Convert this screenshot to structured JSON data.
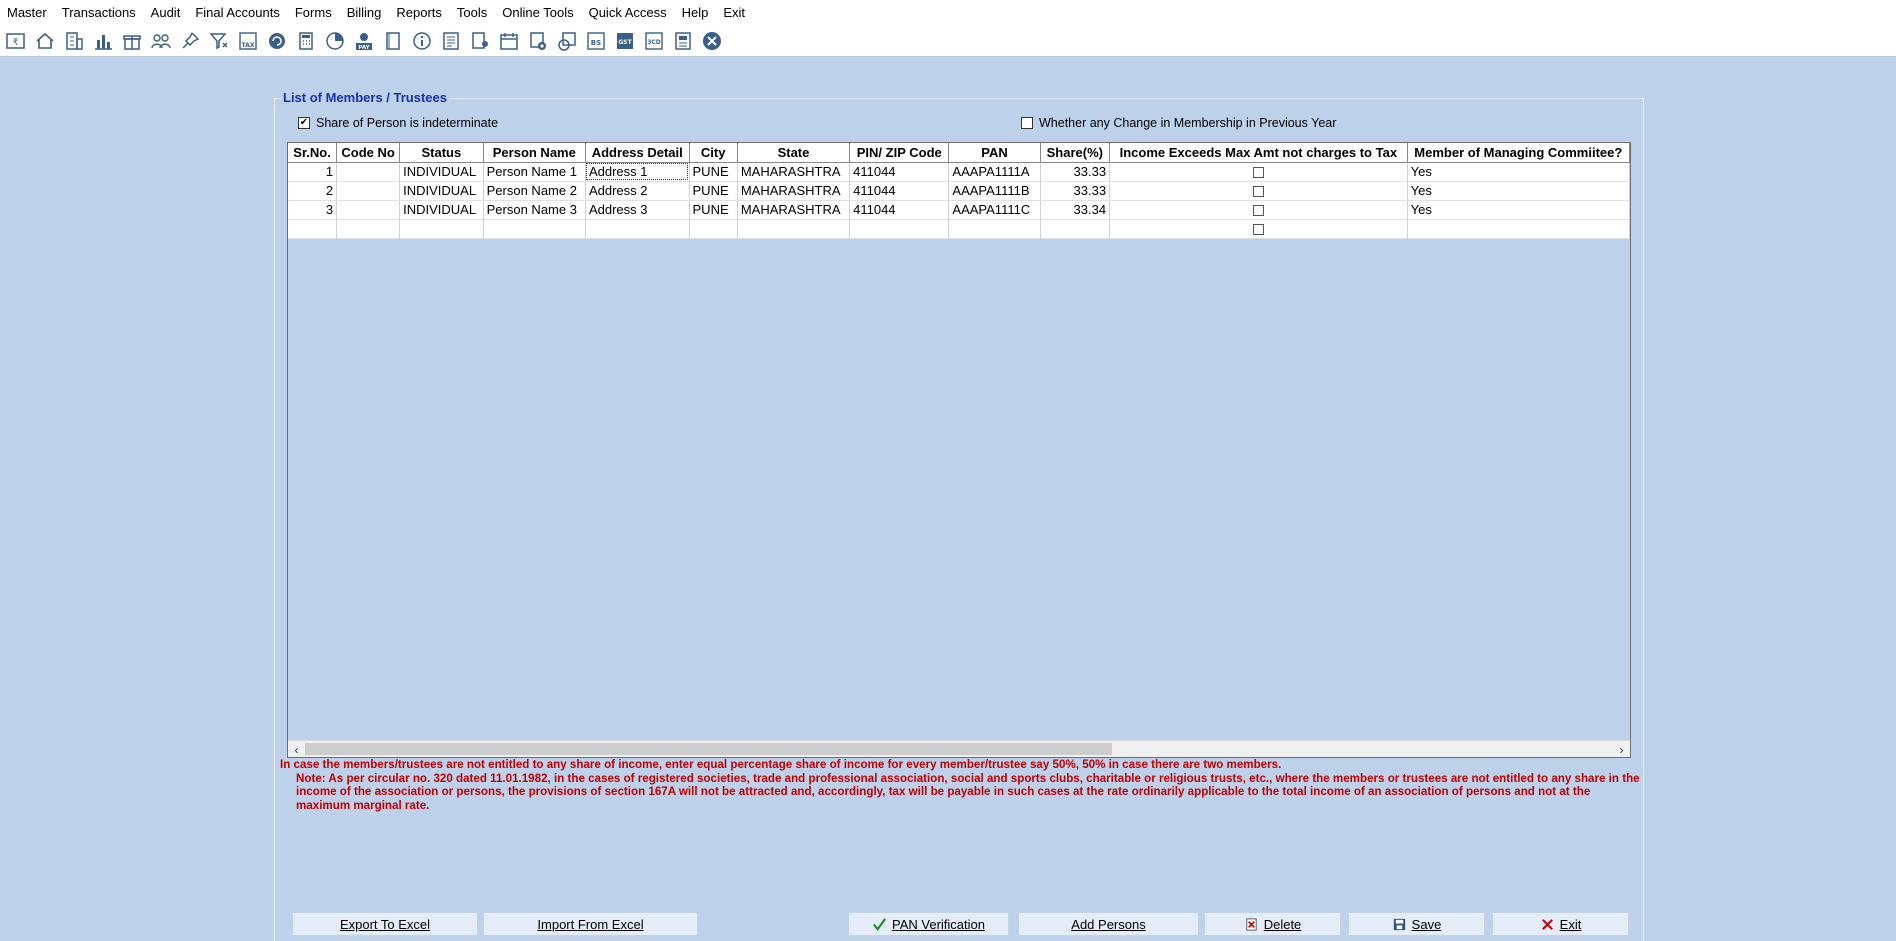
{
  "menu": [
    "Master",
    "Transactions",
    "Audit",
    "Final Accounts",
    "Forms",
    "Billing",
    "Reports",
    "Tools",
    "Online Tools",
    "Quick Access",
    "Help",
    "Exit"
  ],
  "toolbar_icons": [
    "rupee-card-icon",
    "home-icon",
    "building-icon",
    "bar-chart-icon",
    "gift-icon",
    "people-icon",
    "pin-icon",
    "filter-icon",
    "tax-icon",
    "refresh-icon",
    "calculator-icon",
    "pie-chart-icon",
    "pay-icon",
    "book-icon",
    "info-icon",
    "report-icon",
    "user-document-icon",
    "calendar-icon",
    "add-document-icon",
    "browser-icon",
    "bs-icon",
    "gst-icon",
    "3cd-icon",
    "form-icon",
    "close-circle-icon"
  ],
  "group_title": "List of Members / Trustees",
  "share_indeterminate": {
    "label": "Share of Person is indeterminate",
    "checked": true
  },
  "membership_change": {
    "label": "Whether any Change in Membership in Previous Year",
    "checked": false
  },
  "columns": [
    "Sr.No.",
    "Code No",
    "Status",
    "Person Name",
    "Address Detail",
    "City",
    "State",
    "PIN/ ZIP Code",
    "PAN",
    "Share(%)",
    "Income Exceeds Max Amt not charges to Tax",
    "Member of Managing Commiitee?"
  ],
  "rows": [
    {
      "sr": "1",
      "code": "",
      "status": "INDIVIDUAL",
      "name": "Person Name 1",
      "address": "Address 1",
      "city": "PUNE",
      "state": "MAHARASHTRA",
      "pin": "411044",
      "pan": "AAAPA1111A",
      "share": "33.33",
      "member": "Yes"
    },
    {
      "sr": "2",
      "code": "",
      "status": "INDIVIDUAL",
      "name": "Person Name 2",
      "address": "Address 2",
      "city": "PUNE",
      "state": "MAHARASHTRA",
      "pin": "411044",
      "pan": "AAAPA1111B",
      "share": "33.33",
      "member": "Yes"
    },
    {
      "sr": "3",
      "code": "",
      "status": "INDIVIDUAL",
      "name": "Person Name 3",
      "address": "Address 3",
      "city": "PUNE",
      "state": "MAHARASHTRA",
      "pin": "411044",
      "pan": "AAAPA1111C",
      "share": "33.34",
      "member": "Yes"
    }
  ],
  "note_line1": "In case the members/trustees are not entitled to any share of income, enter equal percentage share of income for every member/trustee say 50%, 50% in case there are two members.",
  "note_line2": "Note: As per circular no. 320 dated 11.01.1982, in the cases of registered societies, trade and professional association, social and sports clubs, charitable or religious trusts, etc., where the members or trustees are not entitled to any share in the income of the association or persons, the provisions of section 167A will not be attracted and, accordingly, tax will be payable in such cases at the rate ordinarily applicable to the total income of an association of persons and not at the maximum marginal rate.",
  "buttons": {
    "export": "Export To Excel",
    "import": "Import From Excel",
    "pan": "PAN Verification",
    "add": "Add Persons",
    "delete": "Delete",
    "save": "Save",
    "exit": "Exit"
  }
}
